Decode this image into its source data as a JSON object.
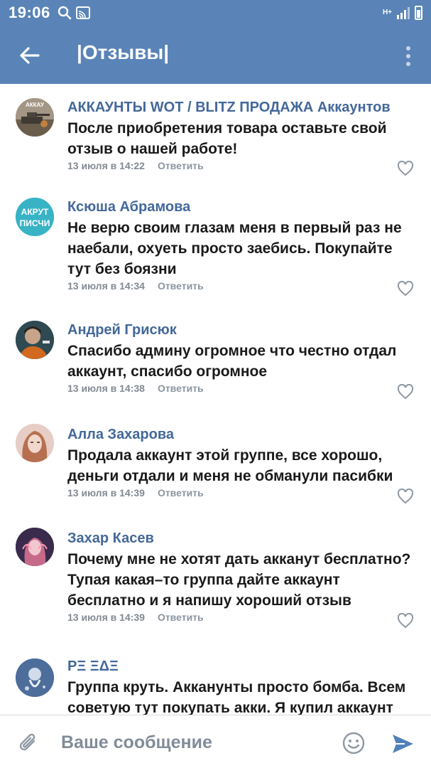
{
  "status_bar": {
    "time": "19:06",
    "left_icons": [
      "search-icon",
      "cast-icon"
    ],
    "right_icons": [
      "network-type-icon",
      "signal-icon",
      "battery-icon"
    ],
    "network_type": "H+"
  },
  "header": {
    "title": "|Отзывы|",
    "back_icon": "arrow-left-icon",
    "menu_icon": "more-vertical-icon",
    "background_color": "#5a84b7"
  },
  "comments": [
    {
      "author": "АККАУНТЫ WOT / BLITZ ПРОДАЖА Аккаунтов",
      "text": "После приобретения товара оставьте свой отзыв о нашей работе!",
      "date": "13 июля в 14:22",
      "reply_label": "Ответить",
      "avatar_text": "АККАУ"
    },
    {
      "author": "Ксюша Абрамова",
      "text": "Не верю своим глазам меня в первый раз не наебали, охуеть просто заебись. Покупайте тут без боязни",
      "date": "13 июля в 14:34",
      "reply_label": "Ответить",
      "avatar_text_1": "АКРУТ",
      "avatar_text_2": "ПИСЧИ"
    },
    {
      "author": "Андрей Грисюк",
      "text": "Спасибо админу огромное что честно отдал аккаунт, спасибо огромное",
      "date": "13 июля в 14:38",
      "reply_label": "Ответить"
    },
    {
      "author": "Алла Захарова",
      "text": "Продала аккаунт этой группе, все хорошо, деньги отдали и меня не обманули пасибки",
      "date": "13 июля в 14:39",
      "reply_label": "Ответить"
    },
    {
      "author": "Захар Касев",
      "text": "Почему мне не хотят дать акканут бесплатно? Тупая какая–то группа дайте аккаунт бесплатно и я напишу хороший отзыв",
      "date": "13 июля в 14:39",
      "reply_label": "Ответить"
    },
    {
      "author": "РΞ ΞΔΞ",
      "text": "Группа круть. Акканунты просто бомба. Всем советую тут покупать акки. Я купил аккаунт"
    }
  ],
  "composer": {
    "placeholder": "Ваше сообщение",
    "attach_icon": "paperclip-icon",
    "emoji_icon": "smile-icon",
    "send_icon": "send-icon",
    "accent_color": "#5181b8"
  }
}
